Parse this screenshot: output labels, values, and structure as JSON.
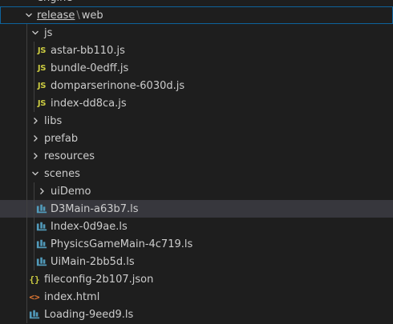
{
  "tree": {
    "top_partial_label": "engine",
    "release_row": {
      "part1": "release",
      "separator": "\\",
      "part2": "web"
    },
    "js_folder": "js",
    "js_files": [
      "astar-bb110.js",
      "bundle-0edff.js",
      "domparserinone-6030d.js",
      "index-dd8ca.js"
    ],
    "libs": "libs",
    "prefab": "prefab",
    "resources": "resources",
    "scenes": "scenes",
    "uidemo": "uiDemo",
    "scene_files": [
      "D3Main-a63b7.ls",
      "Index-0d9ae.ls",
      "PhysicsGameMain-4c719.ls",
      "UiMain-2bb5d.ls"
    ],
    "fileconfig": "fileconfig-2b107.json",
    "index_html": "index.html",
    "loading": "Loading-9eed9.ls"
  },
  "icons": {
    "js": "JS",
    "json": "{}",
    "html": "<>"
  },
  "colors": {
    "background": "#1e1e1e",
    "focus_border": "#0e639c",
    "selected_bg": "#37373d",
    "js_icon": "#cbcb41",
    "ls_icon": "#519aba",
    "html_icon": "#e37933"
  }
}
